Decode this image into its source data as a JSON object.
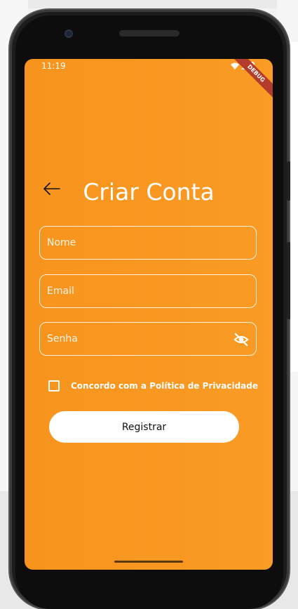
{
  "status_bar": {
    "time": "11:19",
    "debug_label": "DEBUG"
  },
  "page": {
    "title": "Criar Conta"
  },
  "form": {
    "name_placeholder": "Nome",
    "email_placeholder": "Email",
    "password_placeholder": "Senha",
    "consent_label": "Concordo com a Política de Privacidade",
    "register_label": "Registrar"
  },
  "icons": {
    "back": "arrow-left-icon",
    "visibility": "eye-off-icon",
    "wifi": "wifi-icon",
    "signal": "signal-icon",
    "battery": "battery-icon"
  },
  "colors": {
    "background": "#f7941d",
    "button": "#ffffff",
    "text": "#ffffff"
  }
}
